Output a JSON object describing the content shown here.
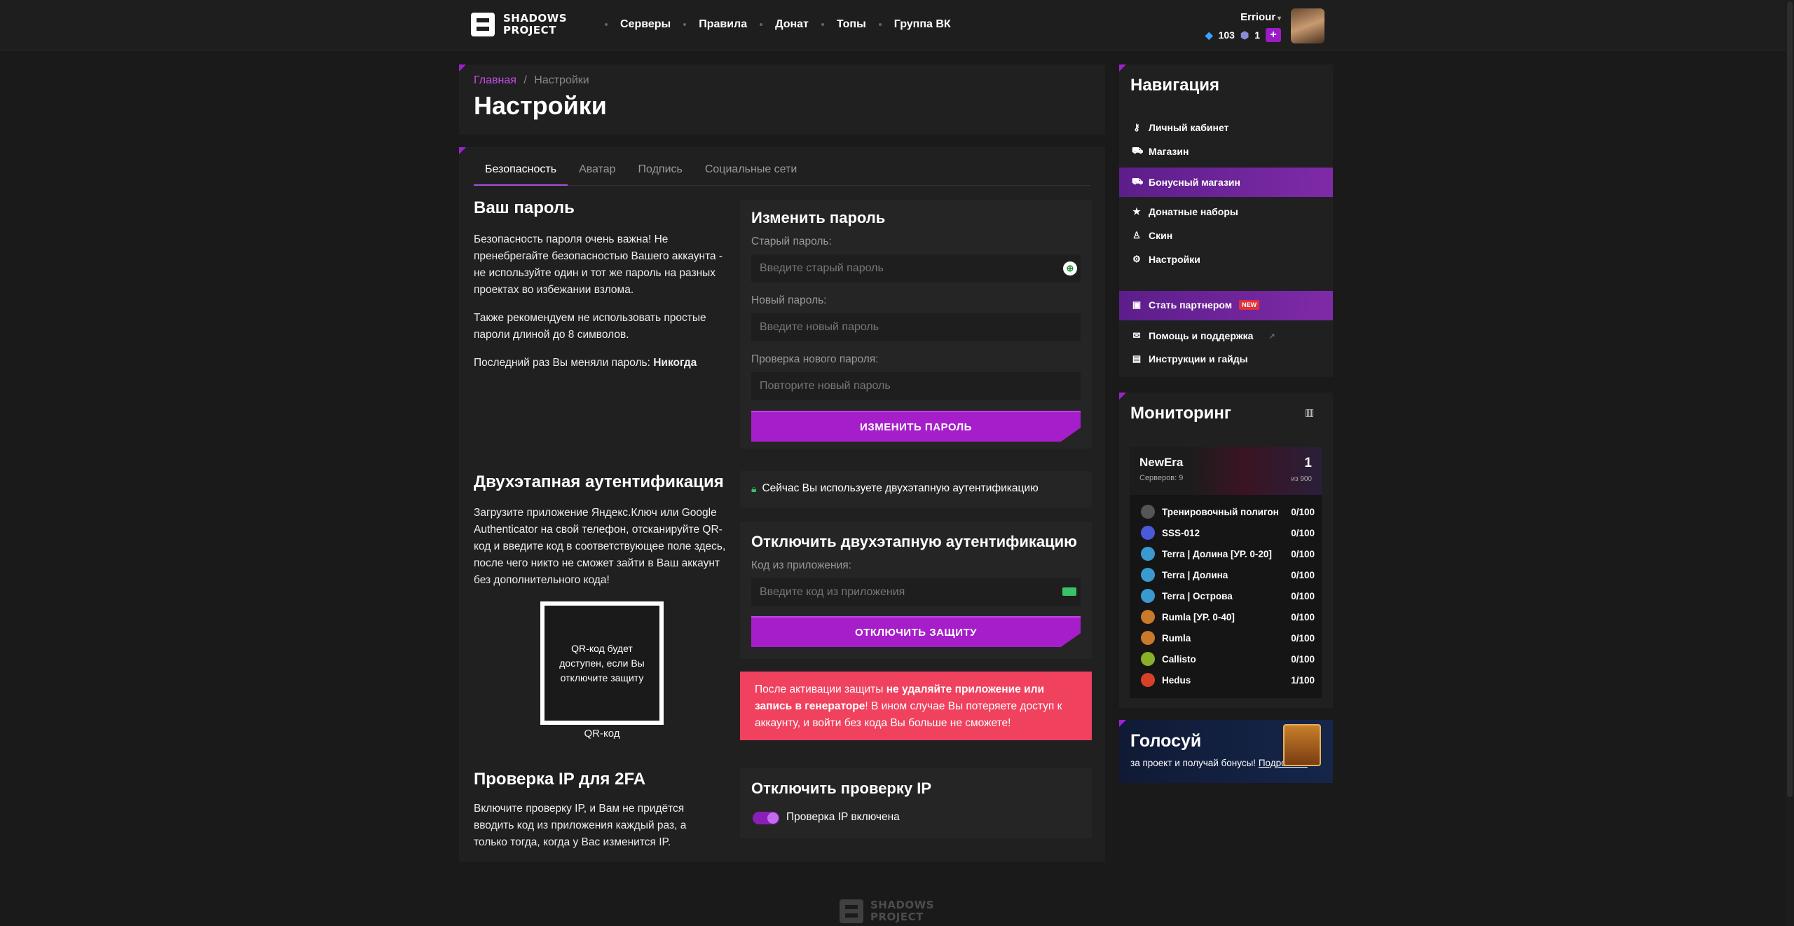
{
  "header": {
    "logo_line1": "SHADOWS",
    "logo_line2": "PROJECT",
    "nav": [
      "Серверы",
      "Правила",
      "Донат",
      "Топы",
      "Группа ВК"
    ],
    "username": "Erriour",
    "gems": "103",
    "crystals": "1",
    "plus": "+"
  },
  "breadcrumb": {
    "home": "Главная",
    "sep": "/",
    "current": "Настройки"
  },
  "page_title": "Настройки",
  "tabs": [
    "Безопасность",
    "Аватар",
    "Подпись",
    "Социальные сети"
  ],
  "password": {
    "title": "Ваш пароль",
    "p1": "Безопасность пароля очень важна! Не пренебрегайте безопасностью Вашего аккаунта - не используйте один и тот же пароль на разных проектах во избежании взлома.",
    "p2": "Также рекомендуем не использовать простые пароли длиной до 8 символов.",
    "last_changed_label": "Последний раз Вы меняли пароль: ",
    "last_changed_value": "Никогда",
    "form_title": "Изменить пароль",
    "old_label": "Старый пароль:",
    "old_placeholder": "Введите старый пароль",
    "new_label": "Новый пароль:",
    "new_placeholder": "Введите новый пароль",
    "confirm_label": "Проверка нового пароля:",
    "confirm_placeholder": "Повторите новый пароль",
    "submit": "ИЗМЕНИТЬ ПАРОЛЬ"
  },
  "twofa": {
    "title": "Двухэтапная аутентификация",
    "description": "Загрузите приложение Яндекс.Ключ или Google Authenticator на свой телефон, отсканируйте QR-код и введите код в соответствующее поле здесь, после чего никто не сможет зайти в Ваш аккаунт без дополнительного кода!",
    "qr_text": "QR-код будет доступен, если Вы отключите защиту",
    "qr_caption": "QR-код",
    "status": "Сейчас Вы используете двухэтапную аутентификацию",
    "disable_title": "Отключить двухэтапную аутентификацию",
    "code_label": "Код из приложения:",
    "code_placeholder": "Введите код из приложения",
    "disable_button": "ОТКЛЮЧИТЬ ЗАЩИТУ",
    "alert_part1": "После активации защиты ",
    "alert_bold": "не удаляйте приложение или запись в генераторе",
    "alert_part2": "! В ином случае Вы потеряете доступ к аккаунту, и войти без кода Вы больше не сможете!"
  },
  "ipcheck": {
    "title": "Проверка IP для 2FA",
    "description": "Включите проверку IP, и Вам не придётся вводить код из приложения каждый раз, а только тогда, когда у Вас изменится IP.",
    "disable_title": "Отключить проверку IP",
    "toggle_label": "Проверка IP включена",
    "enabled": true
  },
  "sidebar": {
    "nav_title": "Навигация",
    "items": [
      {
        "label": "Личный кабинет",
        "icon": "key-icon"
      },
      {
        "label": "Магазин",
        "icon": "cart-icon"
      },
      {
        "label": "Бонусный магазин",
        "icon": "cart-icon"
      },
      {
        "label": "Донатные наборы",
        "icon": "star-icon"
      },
      {
        "label": "Скин",
        "icon": "person-icon"
      },
      {
        "label": "Настройки",
        "icon": "gear-icon"
      }
    ],
    "partner": "Стать партнером",
    "partner_badge": "NEW",
    "help": "Помощь и поддержка",
    "guides": "Инструкции и гайды",
    "monitoring_title": "Мониторинг",
    "monitoring": {
      "name": "NewEra",
      "servers_label": "Серверов: 9",
      "online": "1",
      "max": "из 900",
      "servers": [
        {
          "name": "Тренировочный полигон",
          "count": "0/100",
          "color": "#555555"
        },
        {
          "name": "SSS-012",
          "count": "0/100",
          "color": "#4a5ad8"
        },
        {
          "name": "Terra | Долина [УР. 0-20]",
          "count": "0/100",
          "color": "#3a9ad0"
        },
        {
          "name": "Terra | Долина",
          "count": "0/100",
          "color": "#3a9ad0"
        },
        {
          "name": "Terra | Острова",
          "count": "0/100",
          "color": "#3a9ad0"
        },
        {
          "name": "Rumla [УР. 0-40]",
          "count": "0/100",
          "color": "#c8792a"
        },
        {
          "name": "Rumla",
          "count": "0/100",
          "color": "#c8792a"
        },
        {
          "name": "Callisto",
          "count": "0/100",
          "color": "#8ab02a"
        },
        {
          "name": "Hedus",
          "count": "1/100",
          "color": "#d8402a"
        }
      ]
    },
    "vote_title": "Голосуй",
    "vote_text": "за проект и получай бонусы! ",
    "vote_link": "Подробнее"
  },
  "footer": {
    "logo_line1": "SHADOWS",
    "logo_line2": "PROJECT"
  }
}
